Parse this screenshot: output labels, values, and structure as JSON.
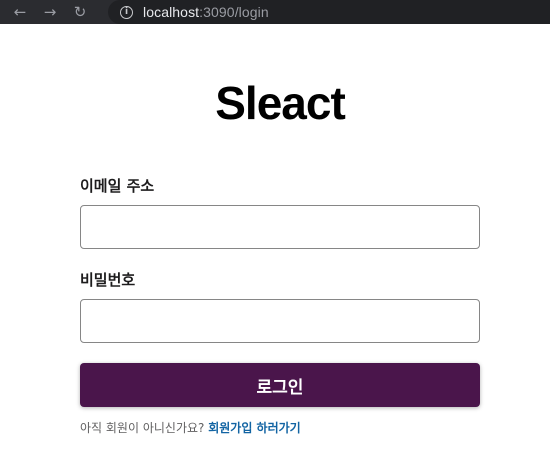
{
  "browser": {
    "back_icon": "←",
    "forward_icon": "→",
    "reload_icon": "↻",
    "info_icon": "i",
    "url_host": "localhost",
    "url_rest": ":3090/login"
  },
  "page": {
    "logo": "Sleact",
    "email_label": "이메일 주소",
    "email_value": "",
    "password_label": "비밀번호",
    "password_value": "",
    "login_button": "로그인",
    "signup_prompt": "아직 회원이 아니신가요? ",
    "signup_link": "회원가입 하러가기"
  },
  "colors": {
    "brand": "#4a154b",
    "link": "#1264a3"
  }
}
